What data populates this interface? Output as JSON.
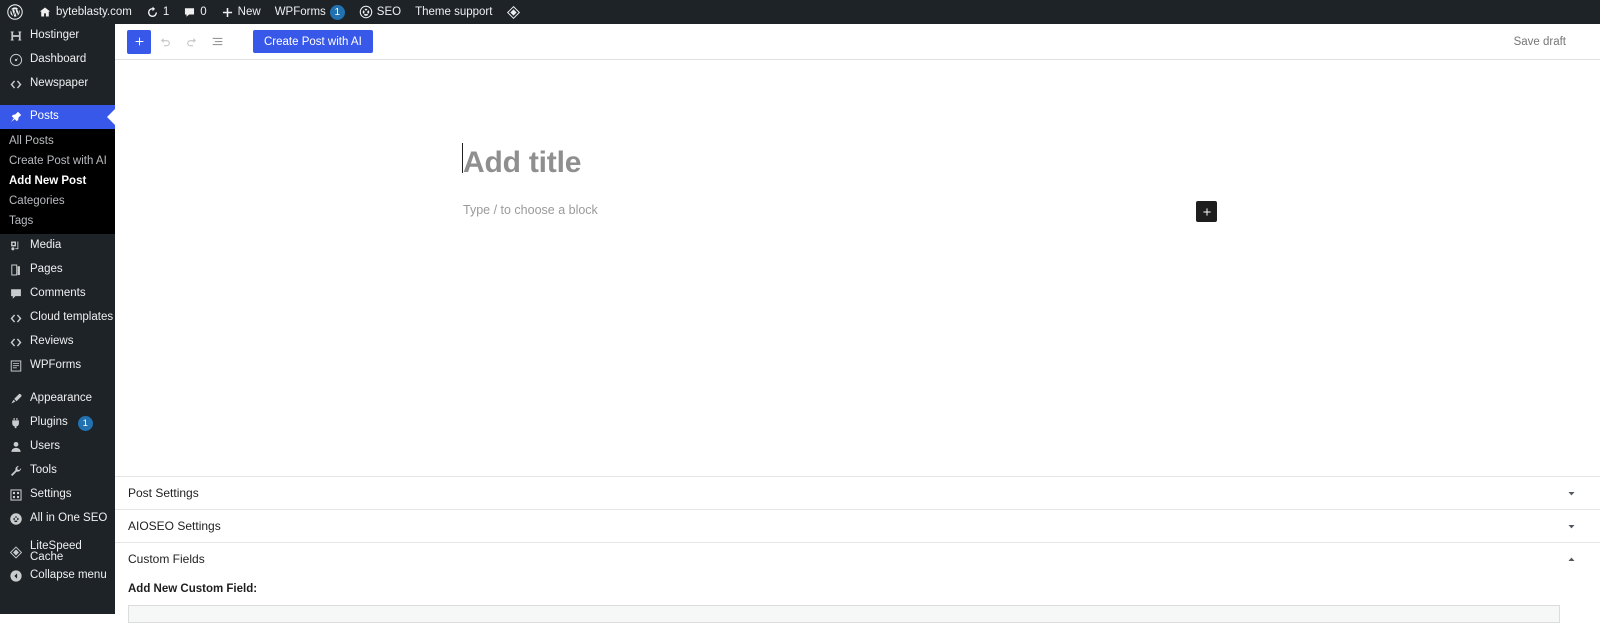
{
  "adminbar": {
    "wp_logo_icon": "wordpress-logo-icon",
    "site_home_icon": "home-icon",
    "site_name": "byteblasty.com",
    "updates_icon": "updates-icon",
    "updates_count": "1",
    "comments_icon": "comment-bubble-icon",
    "comments_count": "0",
    "new_icon": "plus-icon",
    "new_label": "New",
    "wpforms_label": "WPForms",
    "wpforms_badge": "1",
    "seo_icon": "aioseo-icon",
    "seo_label": "SEO",
    "theme_support_label": "Theme support",
    "litespeed_icon": "litespeed-icon"
  },
  "sidebar": {
    "items": [
      {
        "label": "Hostinger",
        "icon": "hostinger-icon",
        "current": false
      },
      {
        "label": "Dashboard",
        "icon": "dashboard-icon",
        "current": false
      },
      {
        "label": "Newspaper",
        "icon": "newspaper-icon",
        "current": false
      },
      {
        "label": "Posts",
        "icon": "pin-icon",
        "current": true
      },
      {
        "label": "Media",
        "icon": "media-icon",
        "current": false
      },
      {
        "label": "Pages",
        "icon": "pages-icon",
        "current": false
      },
      {
        "label": "Comments",
        "icon": "comments-icon",
        "current": false
      },
      {
        "label": "Cloud templates",
        "icon": "cloud-templates-icon",
        "current": false
      },
      {
        "label": "Reviews",
        "icon": "reviews-icon",
        "current": false
      },
      {
        "label": "WPForms",
        "icon": "wpforms-icon",
        "current": false
      },
      {
        "label": "Appearance",
        "icon": "appearance-brush-icon",
        "current": false
      },
      {
        "label": "Plugins",
        "icon": "plugins-icon",
        "current": false,
        "badge": "1"
      },
      {
        "label": "Users",
        "icon": "users-icon",
        "current": false
      },
      {
        "label": "Tools",
        "icon": "tools-wrench-icon",
        "current": false
      },
      {
        "label": "Settings",
        "icon": "settings-icon",
        "current": false
      },
      {
        "label": "All in One SEO",
        "icon": "aioseo-icon",
        "current": false
      },
      {
        "label": "LiteSpeed Cache",
        "icon": "litespeed-icon",
        "current": false
      },
      {
        "label": "Collapse menu",
        "icon": "collapse-arrow-icon",
        "current": false
      }
    ],
    "posts_submenu": [
      {
        "label": "All Posts",
        "current": false
      },
      {
        "label": "Create Post with AI",
        "current": false
      },
      {
        "label": "Add New Post",
        "current": true
      },
      {
        "label": "Categories",
        "current": false
      },
      {
        "label": "Tags",
        "current": false
      }
    ]
  },
  "toolbar": {
    "add_block_icon": "plus-icon",
    "undo_icon": "undo-arrow-icon",
    "redo_icon": "redo-arrow-icon",
    "list_view_icon": "document-overview-icon",
    "create_post_ai_label": "Create Post with AI",
    "save_draft_label": "Save draft",
    "accent_color": "#3858e9"
  },
  "canvas": {
    "title_placeholder": "Add title",
    "block_placeholder": "Type / to choose a block",
    "inserter_icon": "plus-icon"
  },
  "metaboxes": [
    {
      "title": "Post Settings",
      "expanded": false,
      "toggle_icon": "chevron-down-icon"
    },
    {
      "title": "AIOSEO Settings",
      "expanded": false,
      "toggle_icon": "chevron-down-icon"
    },
    {
      "title": "Custom Fields",
      "expanded": true,
      "toggle_icon": "chevron-up-icon"
    }
  ],
  "custom_fields": {
    "add_new_label": "Add New Custom Field:"
  }
}
